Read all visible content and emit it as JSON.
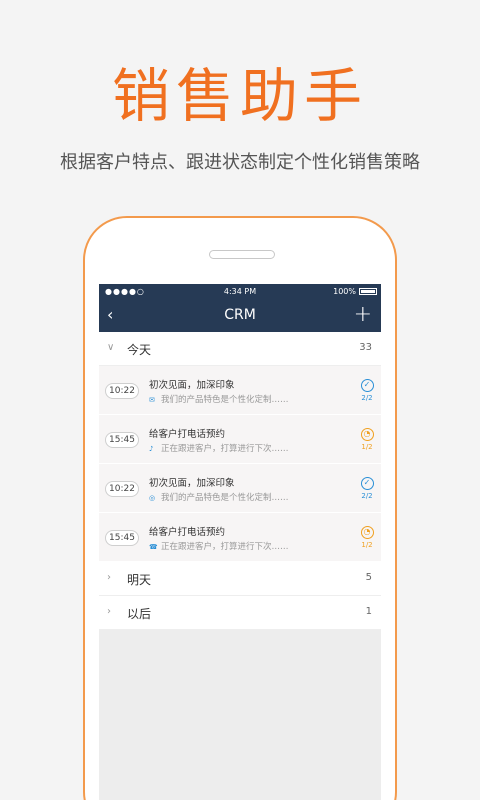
{
  "headline": "销售助手",
  "tagline": "根据客户特点、跟进状态制定个性化销售策略",
  "status_bar": {
    "signal": "●●●●○",
    "time": "4:34 PM",
    "battery": "100%"
  },
  "nav": {
    "title": "CRM",
    "back": "‹",
    "add": "+"
  },
  "sections": [
    {
      "label": "今天",
      "count": "33",
      "chevron": "∨"
    },
    {
      "label": "明天",
      "count": "5",
      "chevron": "›"
    },
    {
      "label": "以后",
      "count": "1",
      "chevron": "›"
    }
  ],
  "tasks": [
    {
      "time": "10:22",
      "title": "初次见面，加深印象",
      "desc": "我们的产品特色是个性化定制……",
      "icon": "mail-icon",
      "status": "done",
      "progress": "2/2"
    },
    {
      "time": "15:45",
      "title": "给客户打电话预约",
      "desc": "正在跟进客户，打算进行下次……",
      "icon": "bell-icon",
      "status": "pending",
      "progress": "1/2"
    },
    {
      "time": "10:22",
      "title": "初次见面，加深印象",
      "desc": "我们的产品特色是个性化定制……",
      "icon": "chat-icon",
      "status": "done",
      "progress": "2/2"
    },
    {
      "time": "15:45",
      "title": "给客户打电话预约",
      "desc": "正在跟进客户，打算进行下次……",
      "icon": "phone-icon",
      "status": "pending",
      "progress": "1/2"
    }
  ],
  "colors": {
    "accent": "#f07020",
    "navbar": "#263a55",
    "done": "#2a8fd6",
    "pending": "#f0a020"
  }
}
